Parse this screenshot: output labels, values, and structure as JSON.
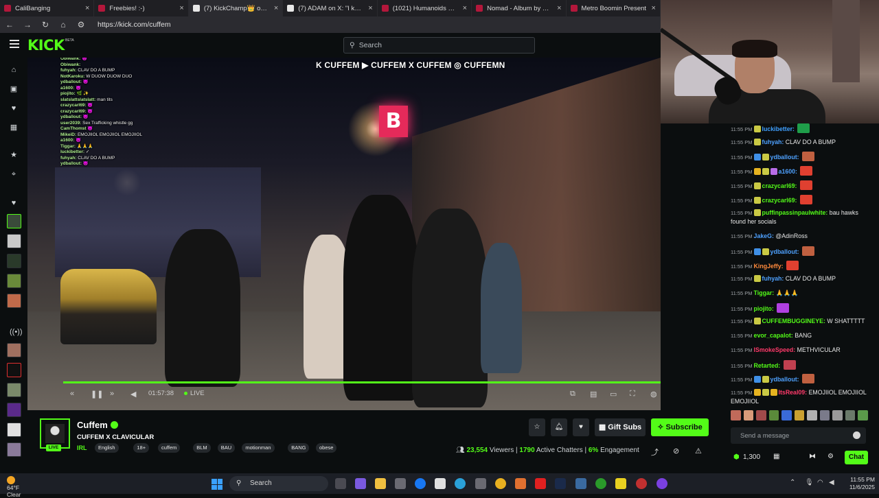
{
  "browser": {
    "tabs": [
      {
        "title": "CaliBanging"
      },
      {
        "title": "Freebies! :-)"
      },
      {
        "title": "(7) KickChamp👑 on X: \"A s"
      },
      {
        "title": "(7) ADAM on X: \"I knew pe"
      },
      {
        "title": "(1021) Humanoids Cost as N"
      },
      {
        "title": "Nomad - Album by DJ Snak"
      },
      {
        "title": "Metro Boomin Present"
      }
    ],
    "url": "https://kick.com/cuffem"
  },
  "header": {
    "logo": "KICK",
    "logo_tag": "BETA",
    "search_placeholder": "Search"
  },
  "video": {
    "social_overlay": "K CUFFEM ▶ CUFFEM X CUFFEM ◎ CUFFEMN",
    "sign_text": "B",
    "overlay_chat": [
      {
        "u": "Obiwank:",
        "m": "😈"
      },
      {
        "u": "Obiwank:",
        "m": ""
      },
      {
        "u": "fuhyah:",
        "m": "CLAV DO A BUMP"
      },
      {
        "u": "NotKaroku:",
        "m": "W DUOW DUOW DUO"
      },
      {
        "u": "ydballout:",
        "m": "😈"
      },
      {
        "u": "a1600:",
        "m": "😈"
      },
      {
        "u": "piojito:",
        "m": "🌿 ✨"
      },
      {
        "u": "slatslattslatslatt:",
        "m": "man tits"
      },
      {
        "u": "crazycarl69:",
        "m": "😈"
      },
      {
        "u": "crazycarl69:",
        "m": "😈"
      },
      {
        "u": "ydballout:",
        "m": "😈"
      },
      {
        "u": "user2039:",
        "m": "Sex Trafficking whistle gg"
      },
      {
        "u": "CamThomst",
        "m": "😈"
      },
      {
        "u": "MikeiD:",
        "m": "EMOJIIOL EMOJIIOL EMOJIIOL"
      },
      {
        "u": "a1600:",
        "m": "😈"
      },
      {
        "u": "Tiggar:",
        "m": "🙏🙏🙏"
      },
      {
        "u": "luckibetter:",
        "m": "✓"
      },
      {
        "u": "fuhyah:",
        "m": "CLAV DO A BUMP"
      },
      {
        "u": "ydballout:",
        "m": "😈"
      }
    ],
    "time": "01:57:38",
    "live_label": "LIVE",
    "progress": 0.99
  },
  "chat": {
    "messages": [
      {
        "time": "11:55 PM",
        "user": "luckibetter:",
        "color": "#3fa0ff",
        "text": "",
        "badges": [
          "#c9c944"
        ],
        "emote": "#1f9e4a"
      },
      {
        "time": "11:55 PM",
        "user": "fuhyah:",
        "color": "#4ea1ff",
        "text": "CLAV DO A BUMP",
        "badges": [
          "#c9c944"
        ],
        "emote": ""
      },
      {
        "time": "11:55 PM",
        "user": "ydballout:",
        "color": "#4ea1ff",
        "text": "",
        "badges": [
          "#3f8fe6",
          "#c9c944"
        ],
        "emote": "#c06040"
      },
      {
        "time": "11:55 PM",
        "user": "a1600:",
        "color": "#4ea1ff",
        "text": "",
        "badges": [
          "#e6b320",
          "#c9c944",
          "#b86de8"
        ],
        "emote": "#e04030"
      },
      {
        "time": "11:55 PM",
        "user": "crazycarl69:",
        "color": "#53fc18",
        "text": "",
        "badges": [
          "#c9c944"
        ],
        "emote": "#e04030"
      },
      {
        "time": "11:55 PM",
        "user": "crazycarl69:",
        "color": "#53fc18",
        "text": "",
        "badges": [
          "#c9c944"
        ],
        "emote": "#e04030"
      },
      {
        "time": "11:55 PM",
        "user": "puffinpassinpaulwhite:",
        "color": "#53fc18",
        "text": "bau hawks found her socials",
        "badges": [
          "#c9c944"
        ],
        "emote": ""
      },
      {
        "time": "11:55 PM",
        "user": "JakeG:",
        "color": "#4ea1ff",
        "text": "@AdinRoss",
        "badges": [],
        "emote": ""
      },
      {
        "time": "11:55 PM",
        "user": "ydballout:",
        "color": "#4ea1ff",
        "text": "",
        "badges": [
          "#3f8fe6",
          "#c9c944"
        ],
        "emote": "#c06040"
      },
      {
        "time": "11:55 PM",
        "user": "KingJeffy:",
        "color": "#ff8a3c",
        "text": "",
        "badges": [],
        "emote": "#e04030"
      },
      {
        "time": "11:55 PM",
        "user": "fuhyah:",
        "color": "#4ea1ff",
        "text": "CLAV DO A BUMP",
        "badges": [
          "#c9c944"
        ],
        "emote": ""
      },
      {
        "time": "11:55 PM",
        "user": "Tiggar:",
        "color": "#53fc18",
        "text": "🙏🙏🙏",
        "badges": [],
        "emote": ""
      },
      {
        "time": "11:55 PM",
        "user": "piojito:",
        "color": "#53fc18",
        "text": "",
        "badges": [],
        "emote": "#b040e0"
      },
      {
        "time": "11:55 PM",
        "user": "CUFFEMBUGGINEYE:",
        "color": "#53fc18",
        "text": "W SHATTTTT",
        "badges": [
          "#c9c944"
        ],
        "emote": ""
      },
      {
        "time": "11:55 PM",
        "user": "evor_capalot:",
        "color": "#53fc18",
        "text": "BANG",
        "badges": [],
        "emote": ""
      },
      {
        "time": "11:55 PM",
        "user": "ISmokeSpeed:",
        "color": "#ff3a6a",
        "text": "METHVICULAR",
        "badges": [],
        "emote": ""
      },
      {
        "time": "11:55 PM",
        "user": "Retarted:",
        "color": "#53fc18",
        "text": "",
        "badges": [],
        "emote": "#c04050"
      },
      {
        "time": "11:55 PM",
        "user": "ydballout:",
        "color": "#4ea1ff",
        "text": "",
        "badges": [
          "#3f8fe6",
          "#c9c944"
        ],
        "emote": "#c06040"
      },
      {
        "time": "11:55 PM",
        "user": "ItsReal09:",
        "color": "#ff3a6a",
        "text": "EMOJIIOL EMOJIIOL EMOJIIOL",
        "badges": [
          "#e6b320",
          "#c9c944",
          "#e6b320"
        ],
        "emote": ""
      }
    ],
    "send_placeholder": "Send a message",
    "points": "1,300",
    "chat_button": "Chat"
  },
  "stream": {
    "streamer": "Cuffem",
    "title": "CUFFEM X CLAVICULAR",
    "live_badge": "LIVE",
    "category": "IRL",
    "tags": [
      "English",
      "18+",
      "cuffem",
      "BLM",
      "BAU",
      "motionman",
      "BANG",
      "obese"
    ],
    "gift_label": "Gift Subs",
    "subscribe_label": "Subscribe",
    "viewers": "23,554",
    "viewers_label": "Viewers",
    "chatters": "1790",
    "chatters_label": "Active Chatters",
    "engagement": "6%",
    "engagement_label": "Engagement"
  },
  "taskbar": {
    "temp": "64°F",
    "condition": "Clear",
    "search": "Search",
    "time": "11:55 PM",
    "date": "11/6/2025"
  },
  "colors": {
    "accent": "#53fc18",
    "bg": "#0b0e0f"
  }
}
